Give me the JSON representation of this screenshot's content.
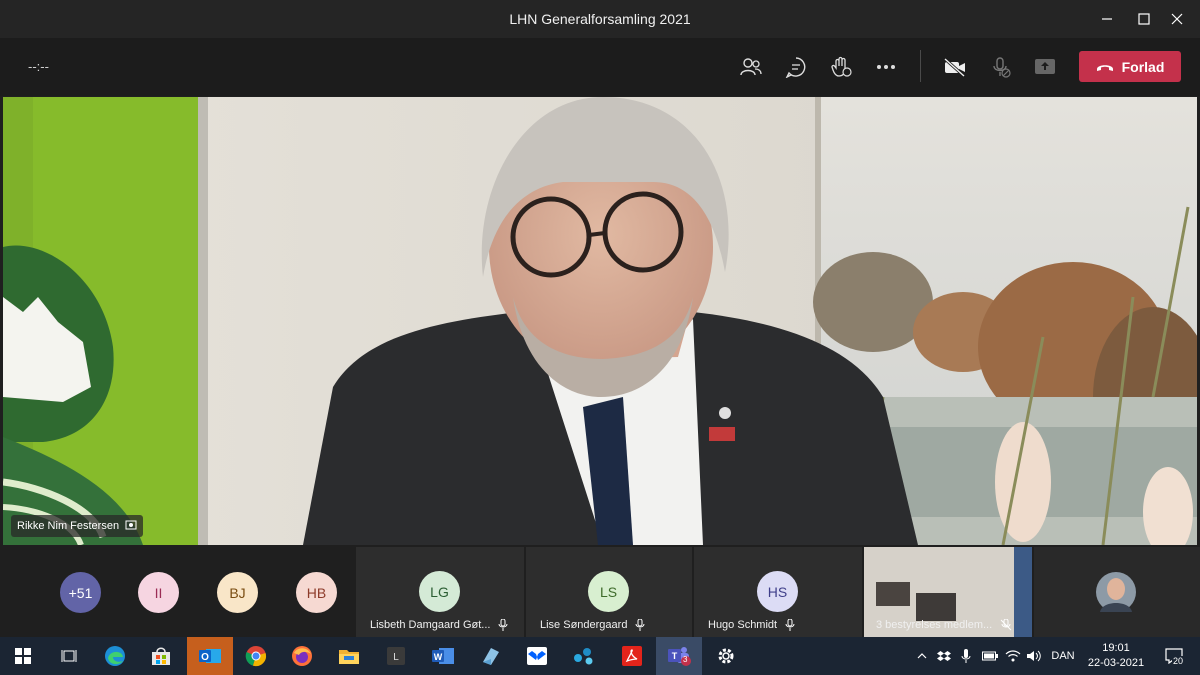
{
  "window": {
    "title": "LHN Generalforsamling 2021"
  },
  "toolbar": {
    "timer": "--:--",
    "leave_label": "Forlad"
  },
  "stage": {
    "speaker_name": "Rikke Nim Festersen"
  },
  "strip": {
    "avatars": [
      {
        "initials": "+51",
        "bg": "#6264a7",
        "fg": "#ffffff"
      },
      {
        "initials": "II",
        "bg": "#f6d5e1",
        "fg": "#9b2c55"
      },
      {
        "initials": "BJ",
        "bg": "#f9e6c8",
        "fg": "#7a4d12"
      },
      {
        "initials": "HB",
        "bg": "#f6d9d2",
        "fg": "#8d3b2a"
      }
    ],
    "tiles": [
      {
        "initials": "LG",
        "name": "Lisbeth Damgaard Gøt...",
        "bg": "#d4ead6",
        "fg": "#2b5e33"
      },
      {
        "initials": "LS",
        "name": "Lise Søndergaard",
        "bg": "#d8efd0",
        "fg": "#3e6b2b"
      },
      {
        "initials": "HS",
        "name": "Hugo Schmidt",
        "bg": "#dcdcf5",
        "fg": "#3f3f8a"
      }
    ],
    "room_tile": {
      "name": "3 bestyrelses medlem..."
    }
  },
  "taskbar": {
    "language": "DAN",
    "time": "19:01",
    "date": "22-03-2021",
    "teams_badge": "3",
    "notification_count": "20",
    "apps": [
      "start-icon",
      "task-view-icon",
      "edge-icon",
      "store-icon",
      "outlook-icon",
      "chrome-icon",
      "firefox-icon",
      "file-explorer-icon",
      "l-app-icon",
      "word-icon",
      "notepad-icon",
      "dropbox-icon",
      "network-app-icon",
      "acrobat-icon",
      "teams-icon",
      "settings-icon"
    ]
  }
}
